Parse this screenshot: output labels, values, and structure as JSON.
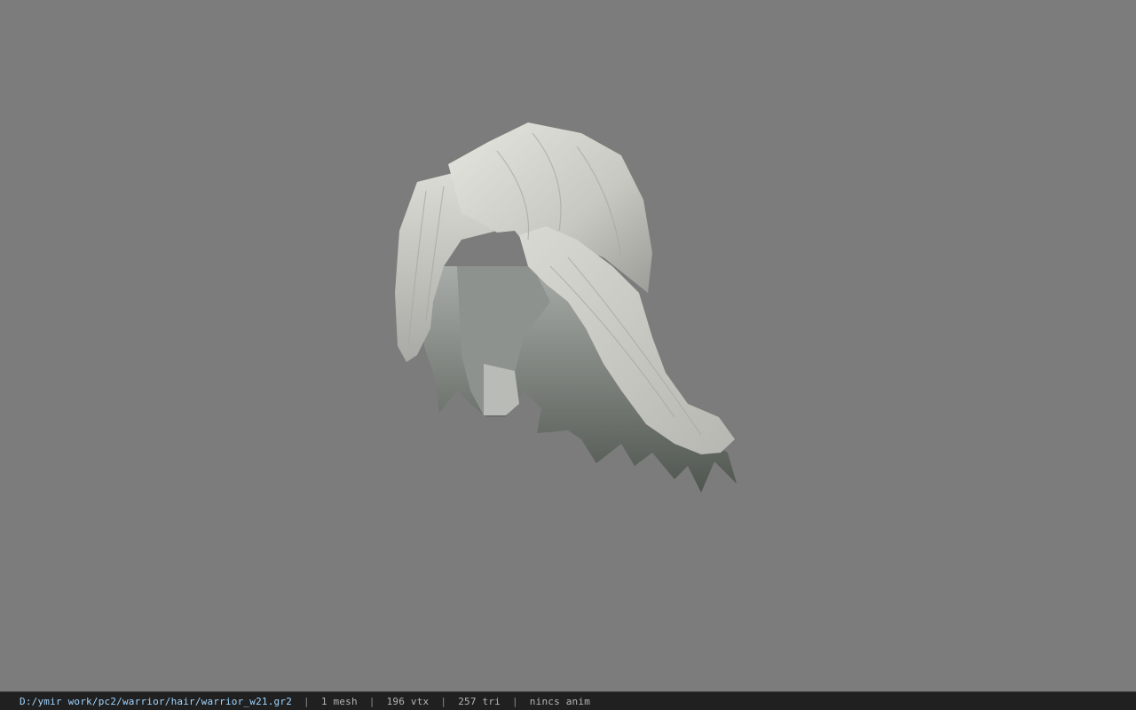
{
  "viewport": {
    "background_color": "#7c7c7c",
    "model_name": "hair-mesh",
    "model_color": "#cfcfc9"
  },
  "statusbar": {
    "file_path": "D:/ymir work/pc2/warrior/hair/warrior_w21.gr2",
    "mesh_count": "1 mesh",
    "vertex_count": "196 vtx",
    "triangle_count": "257 tri",
    "anim_status": "nincs anim",
    "separator": "|"
  }
}
